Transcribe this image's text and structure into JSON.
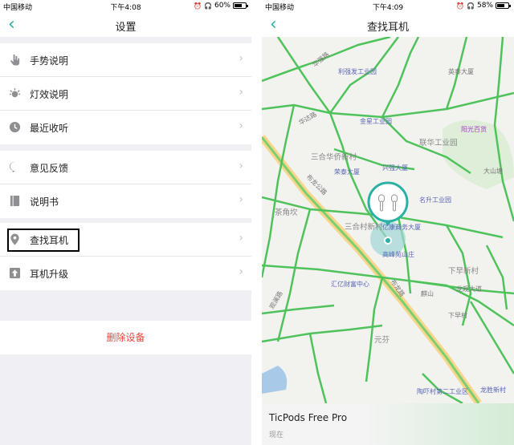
{
  "left": {
    "status": {
      "carrier": "中国移动",
      "time": "下午4:08",
      "battery": "60%",
      "battery_level": 0.6
    },
    "nav": {
      "back": "‹",
      "title": "设置"
    },
    "groups": [
      {
        "items": [
          {
            "label": "手势说明",
            "icon": "hand-icon"
          },
          {
            "label": "灯效说明",
            "icon": "light-icon"
          },
          {
            "label": "最近收听",
            "icon": "clock-icon"
          }
        ]
      },
      {
        "items": [
          {
            "label": "意见反馈",
            "icon": "feedback-icon"
          },
          {
            "label": "说明书",
            "icon": "manual-icon"
          }
        ]
      },
      {
        "items": [
          {
            "label": "查找耳机",
            "icon": "location-pin-icon"
          },
          {
            "label": "耳机升级",
            "icon": "upgrade-icon"
          }
        ]
      }
    ],
    "delete_label": "删除设备"
  },
  "right": {
    "status": {
      "carrier": "中国移动",
      "time": "下午4:09",
      "battery": "58%",
      "battery_level": 0.58
    },
    "nav": {
      "back": "‹",
      "title": "查找耳机"
    },
    "map_labels": {
      "l1": "利强发工业园",
      "l2": "英泰大厦",
      "l3": "金星工业园",
      "l4": "阳光百货",
      "l5": "联华工业园",
      "l6": "三合华侨新村",
      "l7": "兴强大厦",
      "l8": "荣泰大厦",
      "l9": "大山塘",
      "l10": "茶角坎",
      "l11": "名升工业园",
      "l12": "三合村新村",
      "l13": "亿康商务大厦",
      "l14": "高峰苑山庄",
      "l15": "下早新村",
      "l16": "汇亿财富中心",
      "l17": "龙观大道",
      "l18": "麒山",
      "l19": "下早村",
      "l20": "元芬",
      "l21": "陶吓村第二工业区",
      "l22": "龙胜新村",
      "l23": "华强路",
      "l24": "布龙公路",
      "l25": "华达路",
      "l26": "布龙路",
      "l27": "观澜路"
    },
    "device": {
      "name": "TicPods Free Pro",
      "time": "现在"
    }
  }
}
